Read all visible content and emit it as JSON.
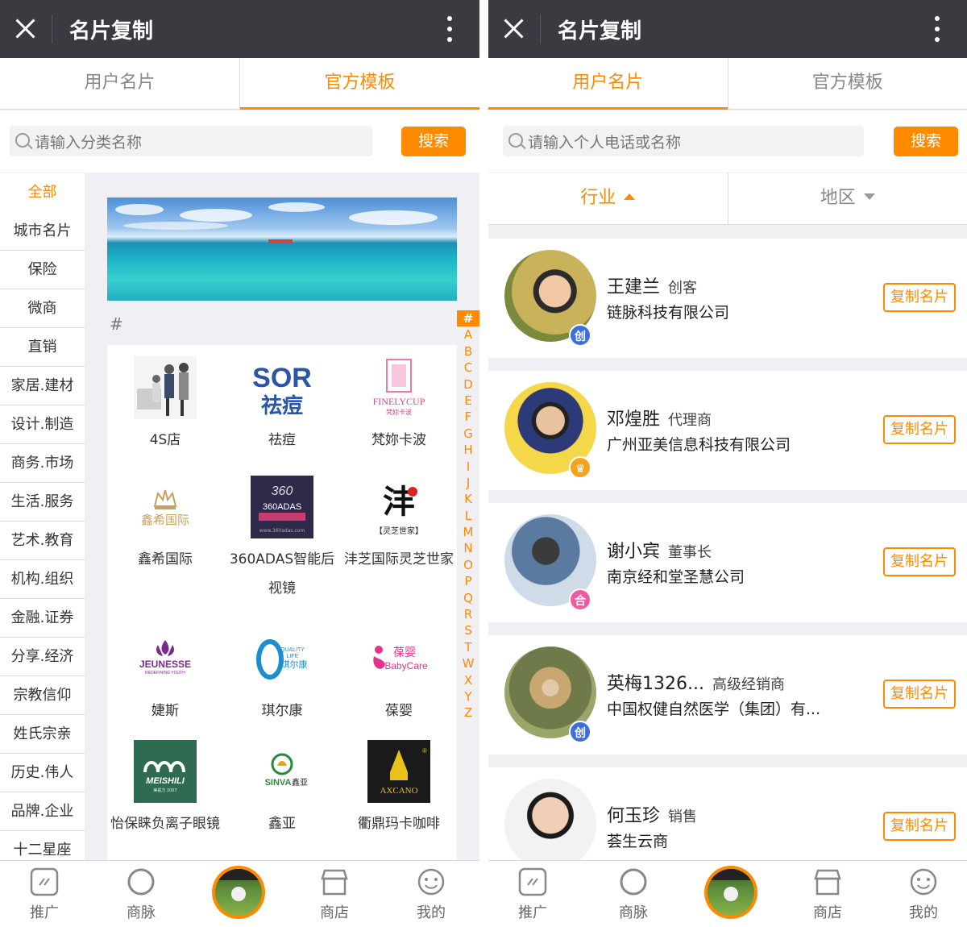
{
  "app_title": "名片复制",
  "tabs": {
    "user_cards": "用户名片",
    "official_templates": "官方模板"
  },
  "left": {
    "search": {
      "placeholder": "请输入分类名称",
      "button": "搜索"
    },
    "categories": [
      "全部",
      "城市名片",
      "保险",
      "微商",
      "直销",
      "家居.建材",
      "设计.制造",
      "商务.市场",
      "生活.服务",
      "艺术.教育",
      "机构.组织",
      "金融.证券",
      "分享.经济",
      "宗教信仰",
      "姓氏宗亲",
      "历史.伟人",
      "品牌.企业",
      "十二星座"
    ],
    "section_label": "#",
    "alphabet": [
      "#",
      "A",
      "B",
      "C",
      "D",
      "E",
      "F",
      "G",
      "H",
      "I",
      "J",
      "K",
      "L",
      "M",
      "N",
      "O",
      "P",
      "Q",
      "R",
      "S",
      "T",
      "W",
      "X",
      "Y",
      "Z"
    ],
    "brands": [
      {
        "name": "4S店",
        "logo_text": ""
      },
      {
        "name": "祛痘",
        "logo_text": "SOR祛痘"
      },
      {
        "name": "梵妳卡波",
        "logo_text": "FINELYCUP"
      },
      {
        "name": "鑫希国际",
        "logo_text": "鑫希国际"
      },
      {
        "name": "360ADAS智能后视镜",
        "logo_text": "360ADAS"
      },
      {
        "name": "沣芝国际灵芝世家",
        "logo_text": "【灵芝世家】"
      },
      {
        "name": "婕斯",
        "logo_text": "JEUNESSE"
      },
      {
        "name": "琪尔康",
        "logo_text": "琪尔康"
      },
      {
        "name": "葆婴",
        "logo_text": "葆婴 BabyCare"
      },
      {
        "name": "怡保睐负离子眼镜",
        "logo_text": "MEISHILI"
      },
      {
        "name": "鑫亚",
        "logo_text": "SINVA 鑫亚"
      },
      {
        "name": "衢鼎玛卡咖啡",
        "logo_text": "AXCANO"
      }
    ]
  },
  "right": {
    "search": {
      "placeholder": "请输入个人电话或名称",
      "button": "搜索"
    },
    "filters": {
      "industry": "行业",
      "region": "地区"
    },
    "copy_label": "复制名片",
    "people": [
      {
        "name": "王建兰",
        "role": "创客",
        "company": "链脉科技有限公司",
        "badge": "创",
        "badge_color": "#3d6fd9"
      },
      {
        "name": "邓煌胜",
        "role": "代理商",
        "company": "广州亚美信息科技有限公司",
        "badge": "♛",
        "badge_color": "#f7a21b"
      },
      {
        "name": "谢小宾",
        "role": "董事长",
        "company": "南京经和堂圣慧公司",
        "badge": "合",
        "badge_color": "#ef5a9e"
      },
      {
        "name": "英梅1326...",
        "role": "高级经销商",
        "company": "中国权健自然医学（集团）有...",
        "badge": "创",
        "badge_color": "#3d6fd9"
      },
      {
        "name": "何玉珍",
        "role": "销售",
        "company": "荟生云商",
        "badge": "",
        "badge_color": ""
      }
    ]
  },
  "bottom_nav": {
    "promote": "推广",
    "network": "商脉",
    "shop": "商店",
    "mine": "我的"
  },
  "colors": {
    "accent": "#ff8a00",
    "titlebar": "#3a3b40"
  }
}
